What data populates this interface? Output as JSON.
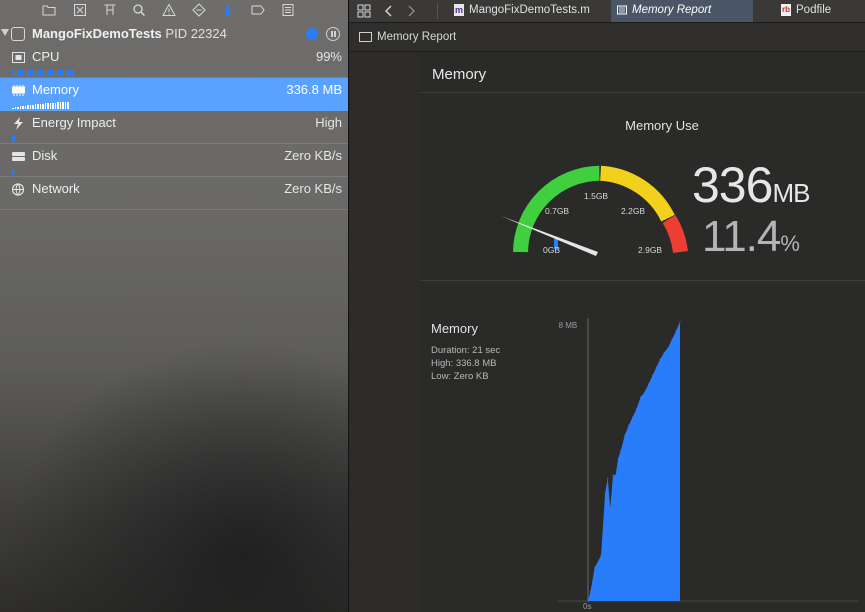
{
  "navigator": {
    "process": {
      "name": "MangoFixDemoTests",
      "pid": "PID 22324"
    },
    "gauges": [
      {
        "label": "CPU",
        "value": "99%",
        "icon": "cpu-icon",
        "selected": false
      },
      {
        "label": "Memory",
        "value": "336.8 MB",
        "icon": "memory-icon",
        "selected": true
      },
      {
        "label": "Energy Impact",
        "value": "High",
        "icon": "energy-icon",
        "selected": false
      },
      {
        "label": "Disk",
        "value": "Zero KB/s",
        "icon": "disk-icon",
        "selected": false
      },
      {
        "label": "Network",
        "value": "Zero KB/s",
        "icon": "network-icon",
        "selected": false
      }
    ]
  },
  "tabs": [
    {
      "label": "MangoFixDemoTests.m",
      "icon": "objc-file-icon"
    },
    {
      "label": "Memory Report",
      "icon": "memory-report-icon",
      "active": true
    },
    {
      "label": "Podfile",
      "icon": "ruby-file-icon"
    }
  ],
  "jumpbar": {
    "label": "Memory Report"
  },
  "report": {
    "section_title": "Memory",
    "gauge": {
      "title": "Memory Use",
      "ticks": [
        "0GB",
        "0.7GB",
        "1.5GB",
        "2.2GB",
        "2.9GB"
      ],
      "used_value": "336",
      "used_unit": "MB",
      "percent_value": "11.4",
      "percent_unit": "%",
      "max_gb": 2.9,
      "used_gb": 0.336,
      "colors": {
        "green": "#3fcf3f",
        "yellow": "#f2d11c",
        "red": "#ec3f31",
        "blue": "#2a7dfa"
      }
    },
    "graph": {
      "title": "Memory",
      "duration": "Duration: 21 sec",
      "high": "High: 336.8 MB",
      "low": "Low: Zero KB",
      "y_max_label": "336.8 MB",
      "x_start_label": "0s"
    }
  },
  "chart_data": {
    "type": "area",
    "title": "Memory",
    "x_unit": "s",
    "y_unit": "MB",
    "ylim": [
      0,
      336.8
    ],
    "x": [
      0,
      0.2,
      0.5,
      1.0,
      1.3,
      1.5,
      1.7,
      1.9,
      2.1,
      2.3,
      2.5,
      2.8,
      3.1,
      3.4,
      3.7,
      4.0,
      4.3,
      4.6,
      4.9,
      5.2,
      5.5,
      5.8,
      6.1,
      6.4,
      6.7,
      7.0
    ],
    "values": [
      0,
      12,
      40,
      55,
      130,
      148,
      112,
      152,
      152,
      172,
      182,
      200,
      212,
      222,
      232,
      246,
      252,
      262,
      272,
      282,
      292,
      300,
      306,
      316,
      326,
      336.8
    ]
  }
}
